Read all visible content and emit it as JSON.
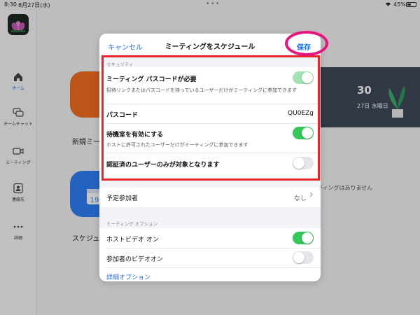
{
  "status_bar": {
    "time": "8:30",
    "date": "8月27日(水)",
    "battery_percent": "45%",
    "battery_level": 0.45
  },
  "sidebar": {
    "items": [
      {
        "label": "ホーム",
        "icon": "home-icon",
        "active": true
      },
      {
        "label": "チームチャット",
        "icon": "chat-icon",
        "active": false
      },
      {
        "label": "ミーティング",
        "icon": "video-icon",
        "active": false
      },
      {
        "label": "連絡先",
        "icon": "contacts-icon",
        "active": false
      },
      {
        "label": "詳細",
        "icon": "more-icon",
        "active": false
      }
    ]
  },
  "background": {
    "new_meeting_label": "新規ミー",
    "schedule_label": "スケジュ",
    "calendar_time": "30",
    "calendar_date": "27日 水曜日",
    "no_meetings_text": "ティングはありません",
    "calendar_icon_text": "19"
  },
  "sheet": {
    "cancel_label": "キャンセル",
    "title": "ミーティングをスケジュール",
    "save_label": "保存",
    "security_section": "セキュリティ",
    "passcode_required": {
      "title": "ミーティング パスコードが必要",
      "description": "招待リンクまたはパスコードを持っているユーザーだけがミーティングに参加できます",
      "enabled": true
    },
    "passcode": {
      "title": "パスコード",
      "value": "QU0EZg"
    },
    "waiting_room": {
      "title": "待機室を有効にする",
      "description": "ホストに許可されたユーザーだけがミーティングに参加できます",
      "enabled": true
    },
    "authenticated_only": {
      "title": "認証済のユーザーのみが対象となります",
      "enabled": false
    },
    "attendees": {
      "title": "予定参加者",
      "value": "なし"
    },
    "options_section": "ミーティング オプション",
    "host_video": {
      "title": "ホストビデオ オン",
      "enabled": true
    },
    "participant_video": {
      "title": "参加者のビデオオン",
      "enabled": false
    },
    "advanced_options_label": "詳細オプション"
  },
  "colors": {
    "accent": "#1a6ff0",
    "toggle_on": "#34c759",
    "annotation_red": "#e8242a",
    "annotation_pink": "#e8157a"
  }
}
